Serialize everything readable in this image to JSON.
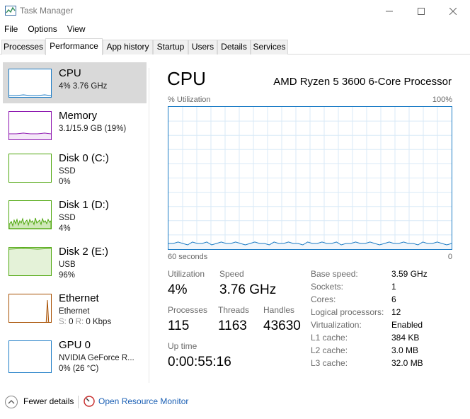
{
  "window": {
    "title": "Task Manager"
  },
  "menu": [
    "File",
    "Options",
    "View"
  ],
  "tabs": [
    "Processes",
    "Performance",
    "App history",
    "Startup",
    "Users",
    "Details",
    "Services"
  ],
  "active_tab": "Performance",
  "sidebar": [
    {
      "title": "CPU",
      "sub1": "4%  3.76 GHz",
      "selected": true,
      "color": "#1b7bc5"
    },
    {
      "title": "Memory",
      "sub1": "3.1/15.9 GB (19%)",
      "color": "#8b12ae"
    },
    {
      "title": "Disk 0 (C:)",
      "sub1": "SSD",
      "sub2": "0%",
      "color": "#4da60c"
    },
    {
      "title": "Disk 1 (D:)",
      "sub1": "SSD",
      "sub2": "4%",
      "color": "#4da60c"
    },
    {
      "title": "Disk 2 (E:)",
      "sub1": "USB",
      "sub2": "96%",
      "color": "#4da60c"
    },
    {
      "title": "Ethernet",
      "sub1": "Ethernet",
      "sub2_s": "S:",
      "sub2_s_val": "0",
      "sub2_r": "R:",
      "sub2_r_val": "0 Kbps",
      "color": "#a74f01"
    },
    {
      "title": "GPU 0",
      "sub1": "NVIDIA GeForce R...",
      "sub2": "0%  (26 °C)",
      "color": "#1b7bc5"
    }
  ],
  "main": {
    "title": "CPU",
    "processor": "AMD Ryzen 5 3600 6-Core Processor",
    "graph": {
      "ylabel": "% Utilization",
      "ymax_label": "100%",
      "xlabel_left": "60 seconds",
      "xlabel_right": "0",
      "series": [
        4,
        4,
        5,
        4,
        3,
        5,
        4,
        4,
        5,
        3,
        4,
        5,
        4,
        4,
        5,
        4,
        3,
        4,
        5,
        4,
        4,
        3,
        5,
        4,
        4,
        5,
        4,
        4,
        3,
        5,
        4,
        4,
        5,
        4,
        4,
        5,
        3,
        4,
        4,
        5,
        4,
        4,
        5,
        4,
        3,
        4,
        5,
        4,
        4,
        5,
        4,
        4,
        3,
        5,
        4,
        4,
        5,
        4,
        3,
        4
      ]
    },
    "stats": {
      "utilization_label": "Utilization",
      "utilization": "4%",
      "speed_label": "Speed",
      "speed": "3.76 GHz",
      "processes_label": "Processes",
      "processes": "115",
      "threads_label": "Threads",
      "threads": "1163",
      "handles_label": "Handles",
      "handles": "43630",
      "uptime_label": "Up time",
      "uptime": "0:00:55:16"
    },
    "specs": [
      {
        "label": "Base speed:",
        "value": "3.59 GHz"
      },
      {
        "label": "Sockets:",
        "value": "1"
      },
      {
        "label": "Cores:",
        "value": "6"
      },
      {
        "label": "Logical processors:",
        "value": "12"
      },
      {
        "label": "Virtualization:",
        "value": "Enabled"
      },
      {
        "label": "L1 cache:",
        "value": "384 KB"
      },
      {
        "label": "L2 cache:",
        "value": "3.0 MB"
      },
      {
        "label": "L3 cache:",
        "value": "32.0 MB"
      }
    ]
  },
  "footer": {
    "fewer_details": "Fewer details",
    "open_resource_monitor": "Open Resource Monitor"
  },
  "icons": {
    "app": "task-manager-icon",
    "minimize": "minimize-icon",
    "maximize": "maximize-icon",
    "close": "close-icon",
    "fewer": "chevron-up-icon",
    "resource_monitor": "resource-monitor-icon"
  }
}
